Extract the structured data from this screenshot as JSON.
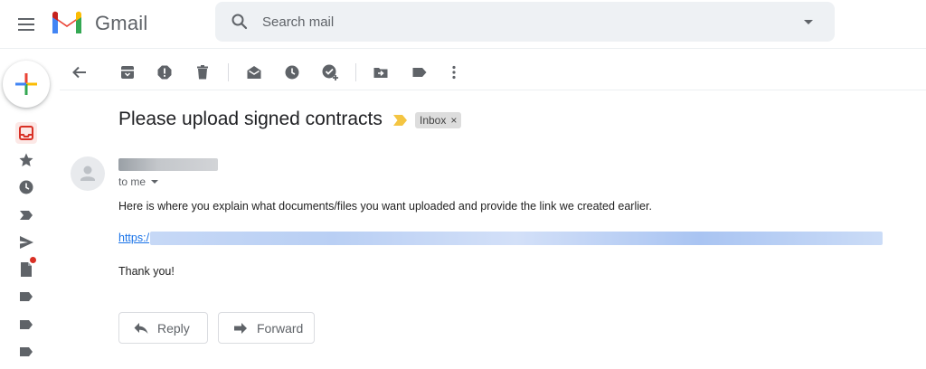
{
  "header": {
    "brand": "Gmail",
    "search_placeholder": "Search mail"
  },
  "sidebar": {
    "items": [
      {
        "icon": "inbox-icon",
        "active": true
      },
      {
        "icon": "star-icon"
      },
      {
        "icon": "clock-icon"
      },
      {
        "icon": "important-icon"
      },
      {
        "icon": "send-icon"
      },
      {
        "icon": "drafts-icon",
        "badge": true
      },
      {
        "icon": "label-icon"
      },
      {
        "icon": "label-icon"
      },
      {
        "icon": "label-icon"
      }
    ]
  },
  "toolbar": {
    "items": [
      "back-icon",
      "archive-icon",
      "report-spam-icon",
      "delete-icon",
      "mark-unread-icon",
      "snooze-icon",
      "add-to-tasks-icon",
      "move-to-icon",
      "labels-icon",
      "more-icon"
    ]
  },
  "email": {
    "subject": "Please upload signed contracts",
    "label": "Inbox",
    "label_close": "×",
    "recipient": "to me",
    "body_line1": "Here is where you explain what documents/files you want uploaded and provide the link we created earlier.",
    "link_prefix": "https:/",
    "closing": "Thank you!"
  },
  "actions": {
    "reply": "Reply",
    "forward": "Forward"
  },
  "colors": {
    "accent_red": "#d93025",
    "link_blue": "#1a73e8",
    "importance_yellow": "#f4c542"
  }
}
